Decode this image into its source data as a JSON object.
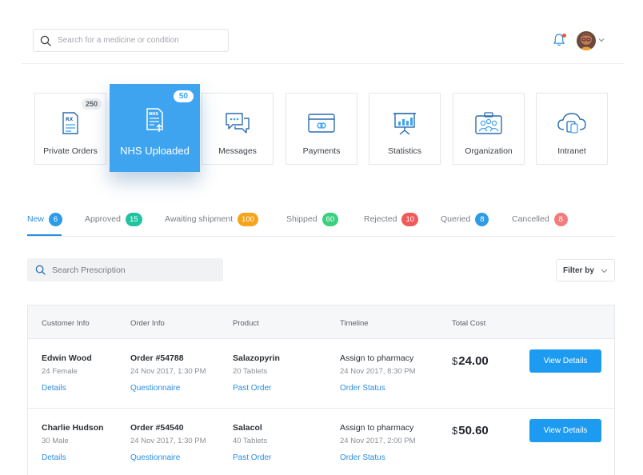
{
  "header": {
    "search_placeholder": "Search for a medicine or condition"
  },
  "colors": {
    "accent": "#3fa4f0",
    "link": "#2b8fe0",
    "button": "#1d9bf0",
    "badge_blue": "#2e9be6",
    "badge_green": "#20c4a0",
    "badge_orange": "#f4a51c",
    "badge_lime": "#3ccf7e",
    "badge_red": "#f05a5a",
    "badge_salmon": "#f47c7c"
  },
  "categories": [
    {
      "label": "Private Orders",
      "badge": "250",
      "icon": "prescription-rx-icon"
    },
    {
      "label": "NHS Uploaded",
      "badge": "50",
      "icon": "nhs-upload-document-icon"
    },
    {
      "label": "Messages",
      "badge": "",
      "icon": "chat-bubbles-icon"
    },
    {
      "label": "Payments",
      "badge": "",
      "icon": "credit-card-icon"
    },
    {
      "label": "Statistics",
      "badge": "",
      "icon": "presentation-chart-icon"
    },
    {
      "label": "Organization",
      "badge": "",
      "icon": "team-id-card-icon"
    },
    {
      "label": "Intranet",
      "badge": "",
      "icon": "cloud-devices-icon"
    }
  ],
  "tabs": [
    {
      "label": "New",
      "count": "6",
      "color": "#2e9be6"
    },
    {
      "label": "Approved",
      "count": "15",
      "color": "#20c4a0"
    },
    {
      "label": "Awaiting shipment",
      "count": "100",
      "color": "#f4a51c"
    },
    {
      "label": "Shipped",
      "count": "60",
      "color": "#3ccf7e"
    },
    {
      "label": "Rejected",
      "count": "10",
      "color": "#f05a5a"
    },
    {
      "label": "Queried",
      "count": "8",
      "color": "#2e9be6"
    },
    {
      "label": "Cancelled",
      "count": "8",
      "color": "#f47c7c"
    }
  ],
  "prescription_search": {
    "placeholder": "Search Prescription"
  },
  "filter": {
    "label": "Filter by"
  },
  "table": {
    "columns": [
      "Customer Info",
      "Order Info",
      "Product",
      "Timeline",
      "Total Cost"
    ],
    "rows": [
      {
        "name": "Edwin Wood",
        "demographics": "24 Female",
        "details_link": "Details",
        "order": "Order #54788",
        "order_date": "24 Nov 2017, 1:30 PM",
        "questionnaire_link": "Questionnaire",
        "product": "Salazopyrin",
        "quantity": "20 Tablets",
        "past_order_link": "Past Order",
        "timeline": "Assign to pharmacy",
        "timeline_date": "24 Nov 2017, 8:30 PM",
        "status_link": "Order Status",
        "currency": "$",
        "total": "24.00",
        "action": "View Details"
      },
      {
        "name": "Charlie Hudson",
        "demographics": "30 Male",
        "details_link": "Details",
        "order": "Order #54540",
        "order_date": "24 Nov 2017, 1:30 PM",
        "questionnaire_link": "Questionnaire",
        "product": "Salacol",
        "quantity": "40 Tablets",
        "past_order_link": "Past Order",
        "timeline": "Assign to pharmacy",
        "timeline_date": "24 Nov 2017, 2:00 PM",
        "status_link": "Order Status",
        "currency": "$",
        "total": "50.60",
        "action": "View Details"
      }
    ]
  }
}
